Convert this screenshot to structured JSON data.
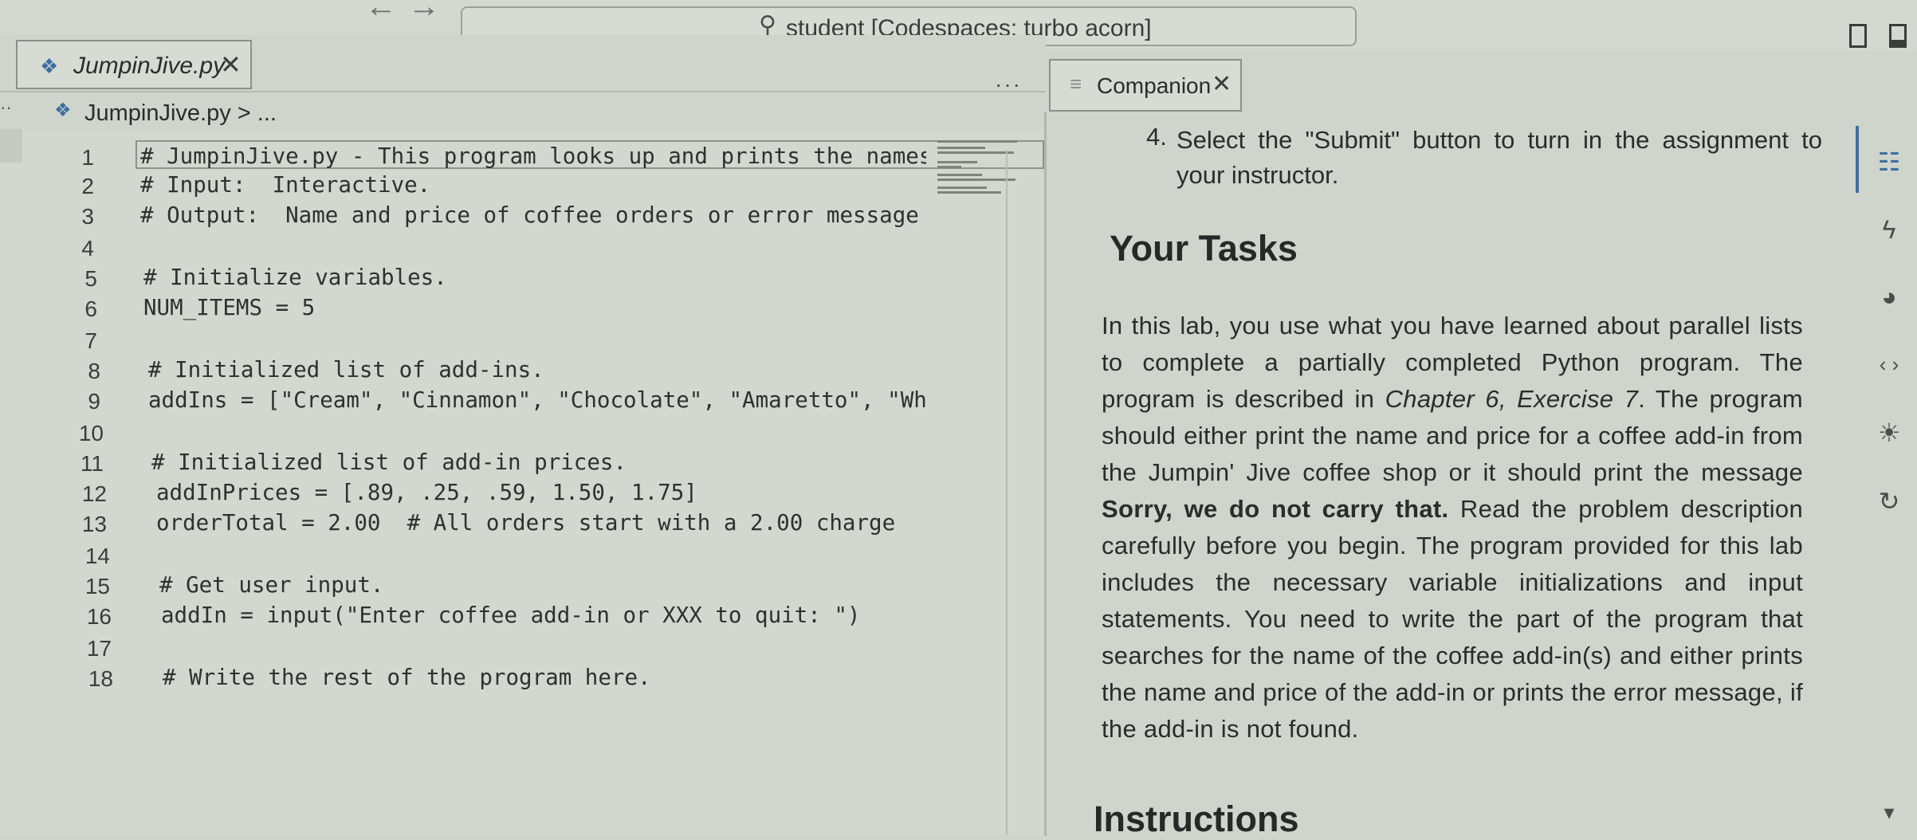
{
  "titlebar": {
    "back_icon": "←",
    "forward_icon": "→",
    "search_icon": "⚲",
    "command_center_text": "student [Codespaces: turbo acorn]"
  },
  "editor_tab": {
    "title": "JumpinJive.py",
    "close": "✕",
    "more_actions": "···"
  },
  "breadcrumb": {
    "dots": "··",
    "path": "JumpinJive.py > ..."
  },
  "code_lines": [
    {
      "num": "1",
      "text": "# JumpinJive.py - This program looks up and prints the names a"
    },
    {
      "num": "2",
      "text": "# Input:  Interactive."
    },
    {
      "num": "3",
      "text": "# Output:  Name and price of coffee orders or error message if"
    },
    {
      "num": "4",
      "text": ""
    },
    {
      "num": "5",
      "text": "# Initialize variables."
    },
    {
      "num": "6",
      "text": "NUM_ITEMS = 5"
    },
    {
      "num": "7",
      "text": ""
    },
    {
      "num": "8",
      "text": "# Initialized list of add-ins."
    },
    {
      "num": "9",
      "text": "addIns = [\"Cream\", \"Cinnamon\", \"Chocolate\", \"Amaretto\", \"Whisk"
    },
    {
      "num": "10",
      "text": ""
    },
    {
      "num": "11",
      "text": "# Initialized list of add-in prices."
    },
    {
      "num": "12",
      "text": "addInPrices = [.89, .25, .59, 1.50, 1.75]"
    },
    {
      "num": "13",
      "text": "orderTotal = 2.00  # All orders start with a 2.00 charge"
    },
    {
      "num": "14",
      "text": ""
    },
    {
      "num": "15",
      "text": "# Get user input."
    },
    {
      "num": "16",
      "text": "addIn = input(\"Enter coffee add-in or XXX to quit: \")"
    },
    {
      "num": "17",
      "text": ""
    },
    {
      "num": "18",
      "text": "# Write the rest of the program here."
    }
  ],
  "companion": {
    "tab_title": "Companion",
    "tab_close": "✕",
    "step_number": "4.",
    "step_text": "Select the \"Submit\" button to turn in the assignment to your instructor.",
    "tasks_heading": "Your Tasks",
    "paragraph": {
      "p1": "In this lab, you use what you have learned about parallel lists to complete a partially completed Python program. The program is described in ",
      "ref": "Chapter 6, Exercise 7",
      "p2": ". The program should either print the name and price for a coffee add-in from the Jumpin' Jive coffee shop or it should print the message ",
      "message": "Sorry, we do not carry that.",
      "p3": " Read the problem description carefully before you begin. The program provided for this lab includes the necessary variable initializations and input statements. You need to write the part of the program that searches for the name of the coffee add-in(s) and either prints the name and price of the add-in or prints the error message, if the add-in is not found."
    },
    "instructions_heading": "Instructions"
  },
  "activity_bar": {
    "list_icon": "☷",
    "lightning_icon": "ϟ",
    "palette_icon": "◕",
    "code_icon": "‹ ›",
    "sun_icon": "☀",
    "refresh_icon": "↻",
    "scroll_down_icon": "▾"
  }
}
